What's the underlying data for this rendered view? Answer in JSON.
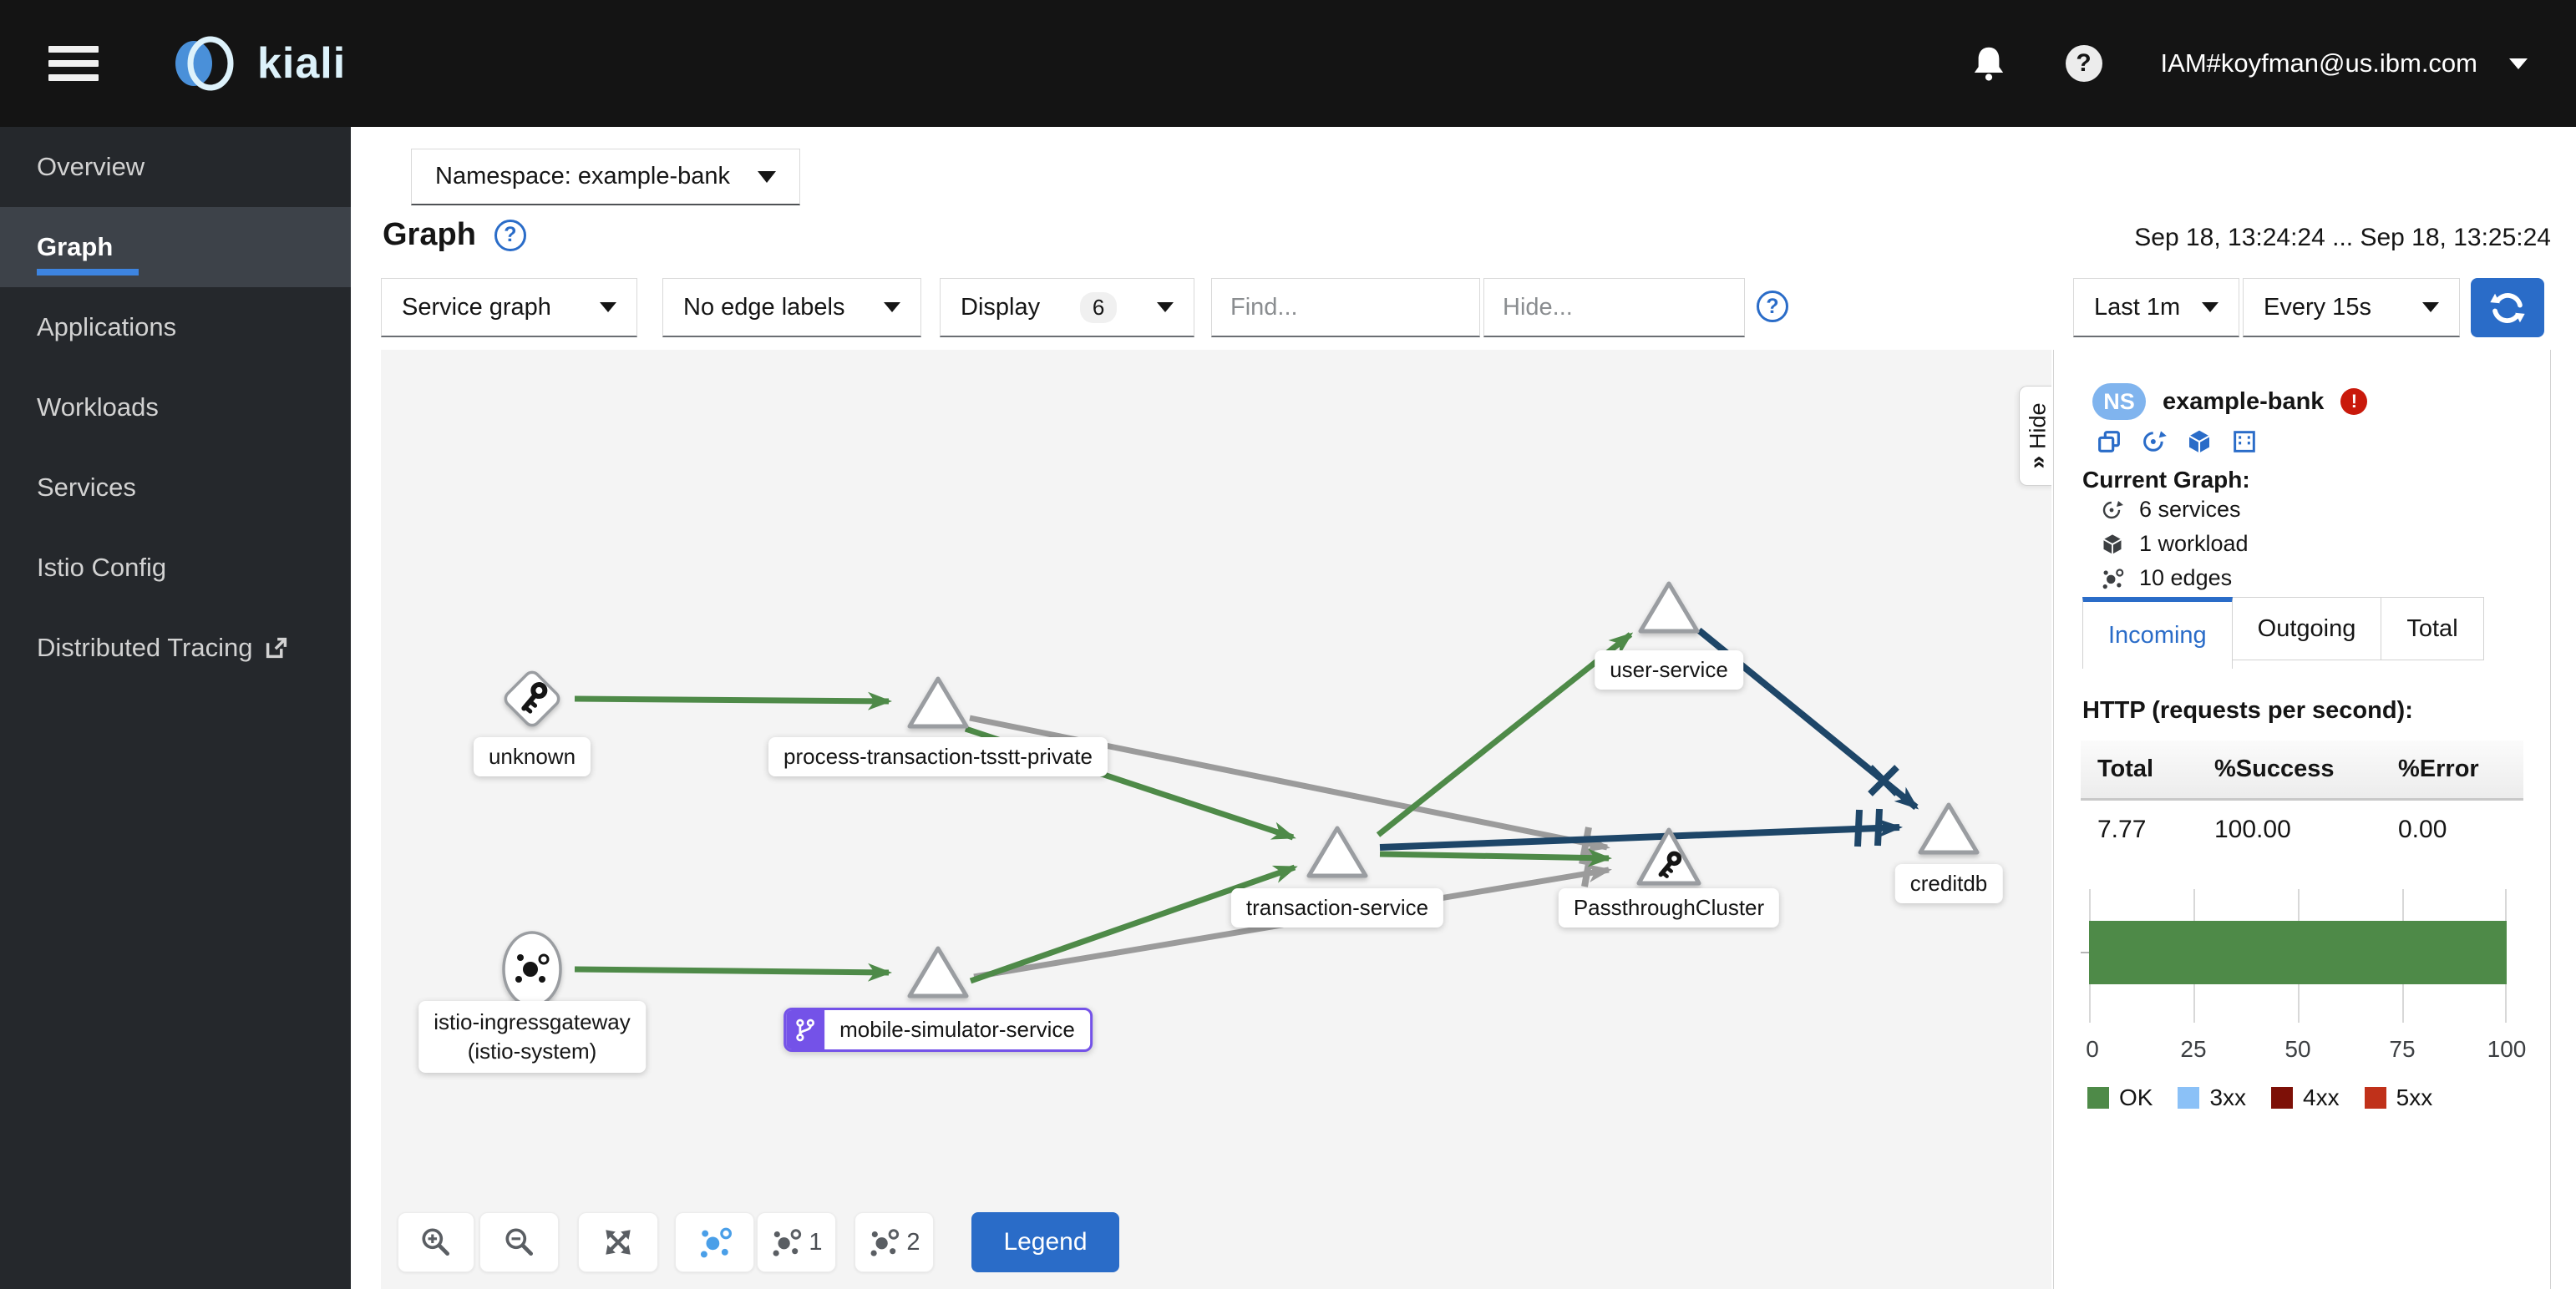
{
  "navbar": {
    "brand": "kiali",
    "user_menu": "IAM#koyfman@us.ibm.com"
  },
  "sidebar": {
    "items": [
      {
        "label": "Overview"
      },
      {
        "label": "Graph"
      },
      {
        "label": "Applications"
      },
      {
        "label": "Workloads"
      },
      {
        "label": "Services"
      },
      {
        "label": "Istio Config"
      },
      {
        "label": "Distributed Tracing"
      }
    ]
  },
  "header": {
    "namespace_selector": "Namespace: example-bank",
    "title": "Graph",
    "time_range": "Sep 18, 13:24:24 ... Sep 18, 13:25:24"
  },
  "toolbar": {
    "graph_type": "Service graph",
    "edge_labels": "No edge labels",
    "display_label": "Display",
    "display_badge": "6",
    "find_placeholder": "Find...",
    "hide_placeholder": "Hide...",
    "duration": "Last 1m",
    "refresh_interval": "Every 15s"
  },
  "graph": {
    "hide_tab": "Hide",
    "legend_button": "Legend",
    "layout1_suffix": "1",
    "layout2_suffix": "2",
    "nodes": {
      "unknown": "unknown",
      "process_transaction": "process-transaction-tsstt-private",
      "user_service": "user-service",
      "transaction_service": "transaction-service",
      "passthrough": "PassthroughCluster",
      "creditdb": "creditdb",
      "ingress_line1": "istio-ingressgateway",
      "ingress_line2": "(istio-system)",
      "mobile_simulator": "mobile-simulator-service"
    }
  },
  "panel": {
    "ns_badge": "NS",
    "namespace": "example-bank",
    "current_graph_title": "Current Graph:",
    "stats": [
      {
        "label": "6 services"
      },
      {
        "label": "1 workload"
      },
      {
        "label": "10 edges"
      }
    ],
    "tabs": [
      {
        "label": "Incoming"
      },
      {
        "label": "Outgoing"
      },
      {
        "label": "Total"
      }
    ],
    "http_title": "HTTP (requests per second):",
    "table": {
      "headers": [
        "Total",
        "%Success",
        "%Error"
      ],
      "row": [
        "7.77",
        "100.00",
        "0.00"
      ]
    },
    "chart_data": {
      "type": "bar",
      "orientation": "horizontal",
      "series": [
        {
          "name": "OK",
          "value": 100,
          "color": "#4e8a48"
        },
        {
          "name": "3xx",
          "value": 0,
          "color": "#8bc1f7"
        },
        {
          "name": "4xx",
          "value": 0,
          "color": "#7d1007"
        },
        {
          "name": "5xx",
          "value": 0,
          "color": "#c0311a"
        }
      ],
      "xticks": [
        "0",
        "25",
        "50",
        "75",
        "100"
      ],
      "xlim": [
        0,
        100
      ],
      "grid": true,
      "legend_position": "bottom"
    }
  },
  "colors": {
    "accent": "#2a6cc8",
    "edge_healthy_green": "#4e8a48",
    "edge_unknown_gray": "#9b9b9b",
    "edge_tcp_navy": "#1e4668",
    "virtual_service_purple": "#7452e8",
    "error_red": "#c9190b"
  }
}
